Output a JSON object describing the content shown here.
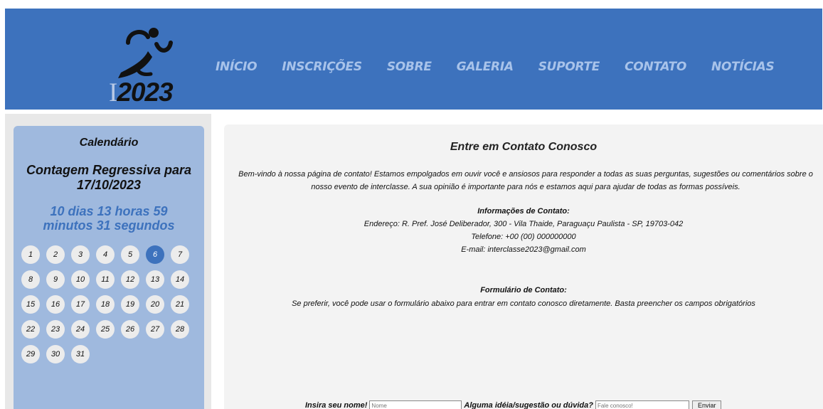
{
  "header": {
    "logo_prefix": "I",
    "logo_year": "2023",
    "nav": [
      "INÍCIO",
      "INSCRIÇÕES",
      "SOBRE",
      "GALERIA",
      "SUPORTE",
      "CONTATO",
      "NOTÍCIAS"
    ],
    "colors": {
      "header_bg": "#3d72bd",
      "nav_text": "#a8c3ea"
    }
  },
  "sidebar": {
    "calendar_title": "Calendário",
    "countdown_title": "Contagem Regressiva para 17/10/2023",
    "countdown_line1": "10 dias 13 horas 59",
    "countdown_line2": "minutos 31 segundos",
    "days": [
      "1",
      "2",
      "3",
      "4",
      "5",
      "6",
      "7",
      "8",
      "9",
      "10",
      "11",
      "12",
      "13",
      "14",
      "15",
      "16",
      "17",
      "18",
      "19",
      "20",
      "21",
      "22",
      "23",
      "24",
      "25",
      "26",
      "27",
      "28",
      "29",
      "30",
      "31"
    ],
    "active_day": "6"
  },
  "main": {
    "title": "Entre em Contato Conosco",
    "intro": "Bem-vindo à nossa página de contato! Estamos empolgados em ouvir você e ansiosos para responder a todas as suas perguntas, sugestões ou comentários sobre o nosso evento de interclasse. A sua opinião é importante para nós e estamos aqui para ajudar de todas as formas possíveis.",
    "info_heading": "Informações de Contato:",
    "address": "Endereço: R. Pref. José Deliberador, 300 - Vila Thaide, Paraguaçu Paulista - SP, 19703-042",
    "phone": "Telefone: +00 (00) 000000000",
    "email": "E-mail: interclasse2023@gmail.com",
    "form_heading": "Formulário de Contato:",
    "form_description": "Se preferir, você pode usar o formulário abaixo para entrar em contato conosco diretamente. Basta preencher os campos obrigatórios",
    "form": {
      "name_label": "Insira seu nome!",
      "name_placeholder": "Nome",
      "message_label": "Alguma idéia/sugestão ou dúvida?",
      "message_placeholder": "Fale conosco!",
      "submit_label": "Enviar"
    }
  }
}
